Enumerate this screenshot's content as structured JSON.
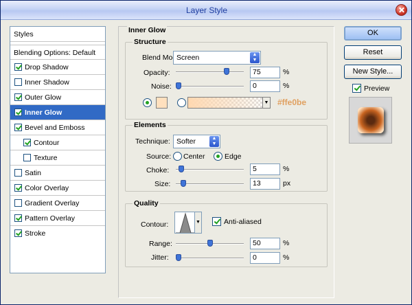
{
  "window": {
    "title": "Layer Style"
  },
  "sidebar": {
    "items": [
      {
        "label": "Styles",
        "type": "header"
      },
      {
        "label": "Blending Options: Default",
        "type": "header"
      },
      {
        "label": "Drop Shadow",
        "checked": true
      },
      {
        "label": "Inner Shadow",
        "checked": false
      },
      {
        "label": "Outer Glow",
        "checked": true
      },
      {
        "label": "Inner Glow",
        "checked": true,
        "selected": true
      },
      {
        "label": "Bevel and Emboss",
        "checked": true
      },
      {
        "label": "Contour",
        "checked": true,
        "indent": true
      },
      {
        "label": "Texture",
        "checked": false,
        "indent": true
      },
      {
        "label": "Satin",
        "checked": false
      },
      {
        "label": "Color Overlay",
        "checked": true
      },
      {
        "label": "Gradient Overlay",
        "checked": false
      },
      {
        "label": "Pattern Overlay",
        "checked": true
      },
      {
        "label": "Stroke",
        "checked": true
      }
    ]
  },
  "panel": {
    "title": "Inner Glow",
    "structure": {
      "title": "Structure",
      "blend_mode_label": "Blend Mode:",
      "blend_mode": "Screen",
      "opacity_label": "Opacity:",
      "opacity": "75",
      "noise_label": "Noise:",
      "noise": "0",
      "percent": "%",
      "color_hex": "#ffe0be",
      "color_hex_label": "#ffe0be"
    },
    "elements": {
      "title": "Elements",
      "technique_label": "Technique:",
      "technique": "Softer",
      "source_label": "Source:",
      "source_center": "Center",
      "source_edge": "Edge",
      "choke_label": "Choke:",
      "choke": "5",
      "size_label": "Size:",
      "size": "13",
      "px": "px"
    },
    "quality": {
      "title": "Quality",
      "contour_label": "Contour:",
      "anti_aliased": "Anti-aliased",
      "range_label": "Range:",
      "range": "50",
      "jitter_label": "Jitter:",
      "jitter": "0"
    }
  },
  "buttons": {
    "ok": "OK",
    "reset": "Reset",
    "new_style": "New Style...",
    "preview": "Preview"
  },
  "colors": {
    "selection": "#316ac5",
    "glow": "#ffe0be",
    "hex_text": "#e0a060"
  }
}
